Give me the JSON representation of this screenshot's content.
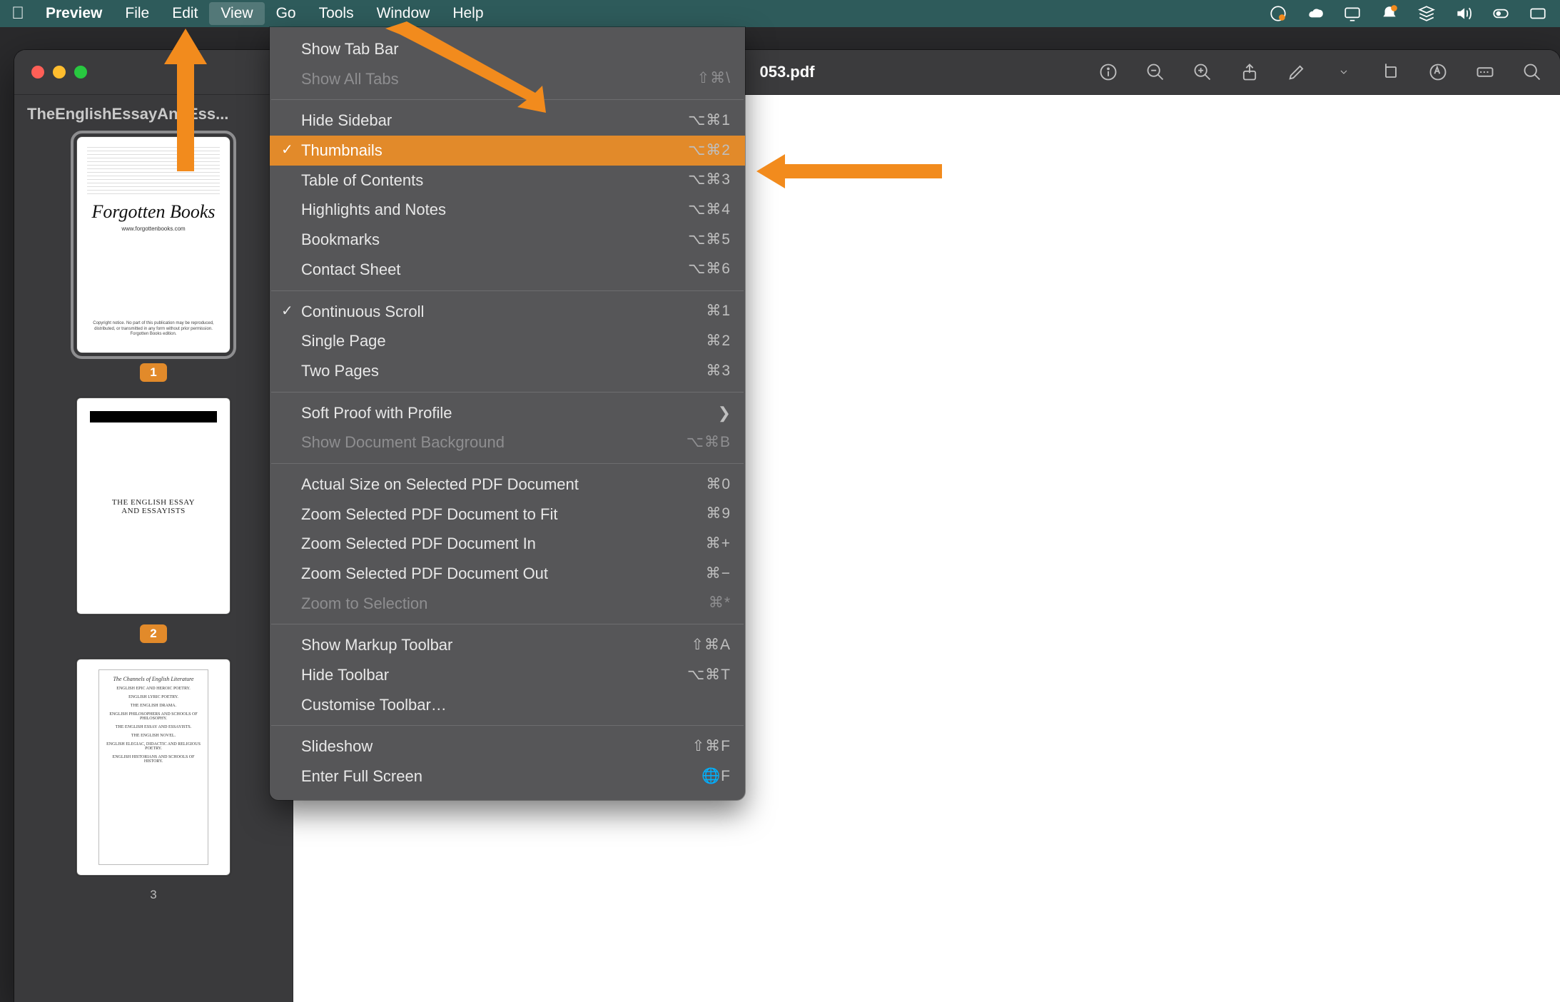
{
  "menubar": {
    "app": "Preview",
    "items": [
      "File",
      "Edit",
      "View",
      "Go",
      "Tools",
      "Window",
      "Help"
    ],
    "open": "View",
    "status_icons": [
      "record-icon",
      "cloud-sync-icon",
      "screen-mirror-icon",
      "notifications-icon",
      "stacks-icon",
      "volume-icon",
      "control-center-icon",
      "battery-icon"
    ]
  },
  "window": {
    "title": "053.pdf",
    "toolbar": [
      "info-icon",
      "zoom-out-icon",
      "zoom-in-icon",
      "share-icon",
      "markup-icon",
      "markup-dropdown-icon",
      "rotate-icon",
      "highlight-icon",
      "form-fields-icon",
      "search-icon"
    ]
  },
  "sidebar": {
    "title": "TheEnglishEssayAndEss...",
    "thumbnails": [
      {
        "num": "1",
        "selected": true,
        "kind": "forgotten"
      },
      {
        "num": "2",
        "selected": false,
        "kind": "titlepage",
        "line1": "THE ENGLISH ESSAY",
        "line2": "AND ESSAYISTS"
      },
      {
        "num": "3",
        "selected": false,
        "kind": "toc"
      }
    ],
    "forgotten": {
      "logo": "Forgotten Books",
      "url": "www.forgottenbooks.com"
    },
    "toc_heading": "The Channels of English Literature"
  },
  "dropdown": {
    "groups": [
      [
        {
          "label": "Show Tab Bar",
          "kb": "",
          "state": "normal"
        },
        {
          "label": "Show All Tabs",
          "kb": "⇧⌘\\",
          "state": "disabled"
        }
      ],
      [
        {
          "label": "Hide Sidebar",
          "kb": "⌥⌘1",
          "state": "normal"
        },
        {
          "label": "Thumbnails",
          "kb": "⌥⌘2",
          "state": "highlight",
          "check": true
        },
        {
          "label": "Table of Contents",
          "kb": "⌥⌘3",
          "state": "normal"
        },
        {
          "label": "Highlights and Notes",
          "kb": "⌥⌘4",
          "state": "normal"
        },
        {
          "label": "Bookmarks",
          "kb": "⌥⌘5",
          "state": "normal"
        },
        {
          "label": "Contact Sheet",
          "kb": "⌥⌘6",
          "state": "normal"
        }
      ],
      [
        {
          "label": "Continuous Scroll",
          "kb": "⌘1",
          "state": "normal",
          "check": true
        },
        {
          "label": "Single Page",
          "kb": "⌘2",
          "state": "normal"
        },
        {
          "label": "Two Pages",
          "kb": "⌘3",
          "state": "normal"
        }
      ],
      [
        {
          "label": "Soft Proof with Profile",
          "kb": "",
          "state": "normal",
          "submenu": true
        },
        {
          "label": "Show Document Background",
          "kb": "⌥⌘B",
          "state": "disabled"
        }
      ],
      [
        {
          "label": "Actual Size on Selected PDF Document",
          "kb": "⌘0",
          "state": "normal"
        },
        {
          "label": "Zoom Selected PDF Document to Fit",
          "kb": "⌘9",
          "state": "normal"
        },
        {
          "label": "Zoom Selected PDF Document In",
          "kb": "⌘+",
          "state": "normal"
        },
        {
          "label": "Zoom Selected PDF Document Out",
          "kb": "⌘−",
          "state": "normal"
        },
        {
          "label": "Zoom to Selection",
          "kb": "⌘*",
          "state": "disabled"
        }
      ],
      [
        {
          "label": "Show Markup Toolbar",
          "kb": "⇧⌘A",
          "state": "normal"
        },
        {
          "label": "Hide Toolbar",
          "kb": "⌥⌘T",
          "state": "normal"
        },
        {
          "label": "Customise Toolbar…",
          "kb": "",
          "state": "normal"
        }
      ],
      [
        {
          "label": "Slideshow",
          "kb": "⇧⌘F",
          "state": "normal"
        },
        {
          "label": "Enter Full Screen",
          "kb": "🌐F",
          "state": "normal"
        }
      ]
    ]
  }
}
